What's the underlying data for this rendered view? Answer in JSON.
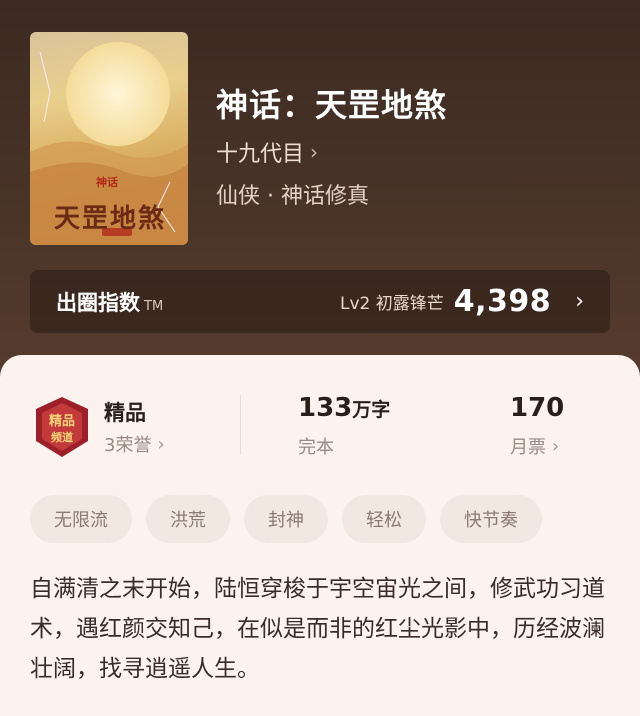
{
  "book": {
    "cover_tag": "神话",
    "cover_title": "天罡地煞",
    "title": "神话：天罡地煞",
    "author": "十九代目",
    "genre": "仙侠 · 神话修真"
  },
  "index_bar": {
    "label": "出圈指数",
    "tm": "TM",
    "level": "Lv2 初露锋芒",
    "value": "4,398"
  },
  "stats": {
    "quality": "精品",
    "honors": "3荣誉",
    "word_count": "133",
    "word_unit": "万字",
    "status": "完本",
    "monthly_tickets": "170",
    "tickets_label": "月票"
  },
  "tags": [
    "无限流",
    "洪荒",
    "封神",
    "轻松",
    "快节奏"
  ],
  "description": "自满清之末开始，陆恒穿梭于宇空宙光之间，修武功习道术，遇红颜交知己，在似是而非的红尘光影中，历经波澜壮阔，找寻逍遥人生。",
  "colors": {
    "header_bg": "#4a3428",
    "card_bg": "#fcf2ee",
    "tag_bg": "#f3e7e2"
  }
}
